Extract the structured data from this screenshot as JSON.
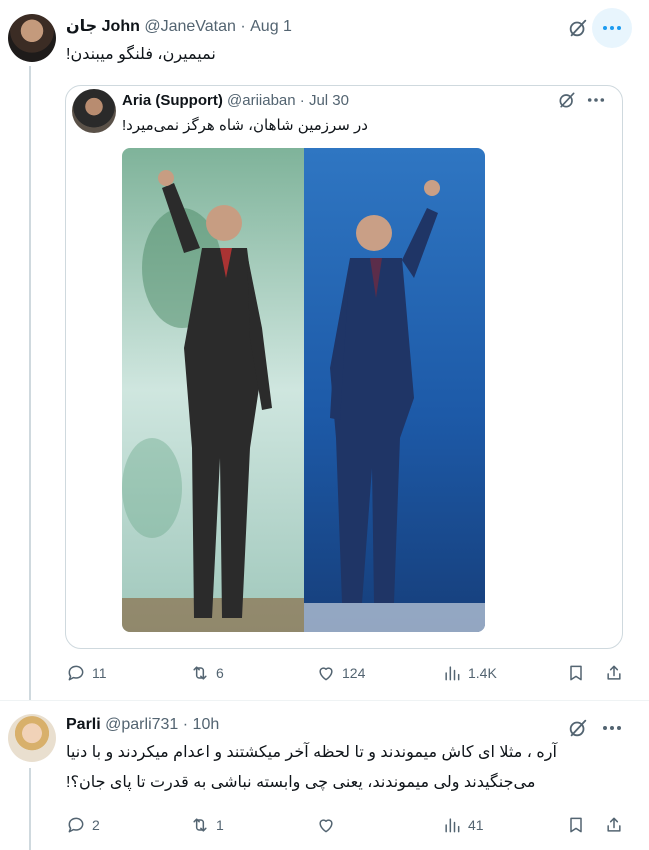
{
  "tweet1": {
    "display_name": "جان John",
    "handle": "@JaneVatan",
    "time": "Aug 1",
    "text": "نمیمیرن، فلنگو میبندن!",
    "actions": {
      "replies": "11",
      "retweets": "6",
      "likes": "124",
      "views": "1.4K"
    }
  },
  "quoted": {
    "display_name": "Aria (Support)",
    "handle": "@ariiaban",
    "time": "Jul 30",
    "text": "در سرزمین شاهان، شاه هرگز نمی‌میرد!"
  },
  "tweet2": {
    "display_name": "Parli",
    "handle": "@parli731",
    "time": "10h",
    "text_line1": "آره ، مثلا ای کاش میموندند و تا لحظه آخر میکشتند و اعدام میکردند و با دنیا",
    "text_line2": "می‌جنگیدند ولی میموندند، یعنی چی وابسته نباشی به قدرت تا پای جان؟!",
    "actions": {
      "replies": "2",
      "retweets": "1",
      "likes": "",
      "views": "41"
    }
  },
  "colors": {
    "accent": "#1d9bf0",
    "muted": "#536471",
    "border": "#cfd9de"
  },
  "icons": [
    "grok-icon",
    "more-icon",
    "reply-icon",
    "retweet-icon",
    "like-icon",
    "views-icon",
    "bookmark-icon",
    "share-icon"
  ]
}
